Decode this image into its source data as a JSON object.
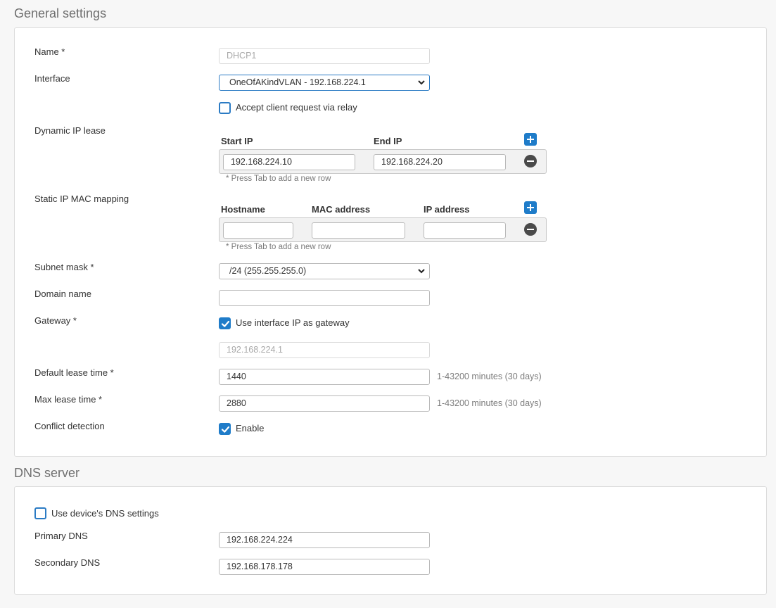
{
  "general": {
    "title": "General settings",
    "name_label": "Name *",
    "name_value": "DHCP1",
    "interface_label": "Interface",
    "interface_value": "OneOfAKindVLAN - 192.168.224.1",
    "relay_label": "Accept client request via relay",
    "relay_checked": false,
    "dynamic_label": "Dynamic IP lease",
    "dynamic": {
      "headers": [
        "Start IP",
        "End IP"
      ],
      "rows": [
        {
          "start": "192.168.224.10",
          "end": "192.168.224.20"
        }
      ],
      "hint": "* Press Tab to add a new row"
    },
    "static_label": "Static IP MAC mapping",
    "static": {
      "headers": [
        "Hostname",
        "MAC address",
        "IP address"
      ],
      "rows": [
        {
          "hostname": "",
          "mac": "",
          "ip": ""
        }
      ],
      "hint": "* Press Tab to add a new row"
    },
    "subnet_label": "Subnet mask *",
    "subnet_value": "/24 (255.255.255.0)",
    "domain_label": "Domain name",
    "domain_value": "",
    "gateway_label": "Gateway *",
    "gateway_checkbox_label": "Use interface IP as gateway",
    "gateway_checked": true,
    "gateway_value": "192.168.224.1",
    "default_lease_label": "Default lease time *",
    "default_lease_value": "1440",
    "default_lease_unit": "1-43200 minutes (30 days)",
    "max_lease_label": "Max lease time *",
    "max_lease_value": "2880",
    "max_lease_unit": "1-43200 minutes (30 days)",
    "conflict_label": "Conflict detection",
    "conflict_checkbox_label": "Enable",
    "conflict_checked": true
  },
  "dns": {
    "title": "DNS server",
    "use_device_label": "Use device's DNS settings",
    "use_device_checked": false,
    "primary_label": "Primary DNS",
    "primary_value": "192.168.224.224",
    "secondary_label": "Secondary DNS",
    "secondary_value": "192.168.178.178"
  },
  "colors": {
    "accent": "#1f7cc9",
    "panel_border": "#dcdcdc",
    "background": "#f7f7f7"
  },
  "icons": {
    "add": "plus-icon",
    "remove": "minus-circle-icon",
    "dropdown": "chevron-down-icon",
    "check": "checkmark-icon"
  }
}
